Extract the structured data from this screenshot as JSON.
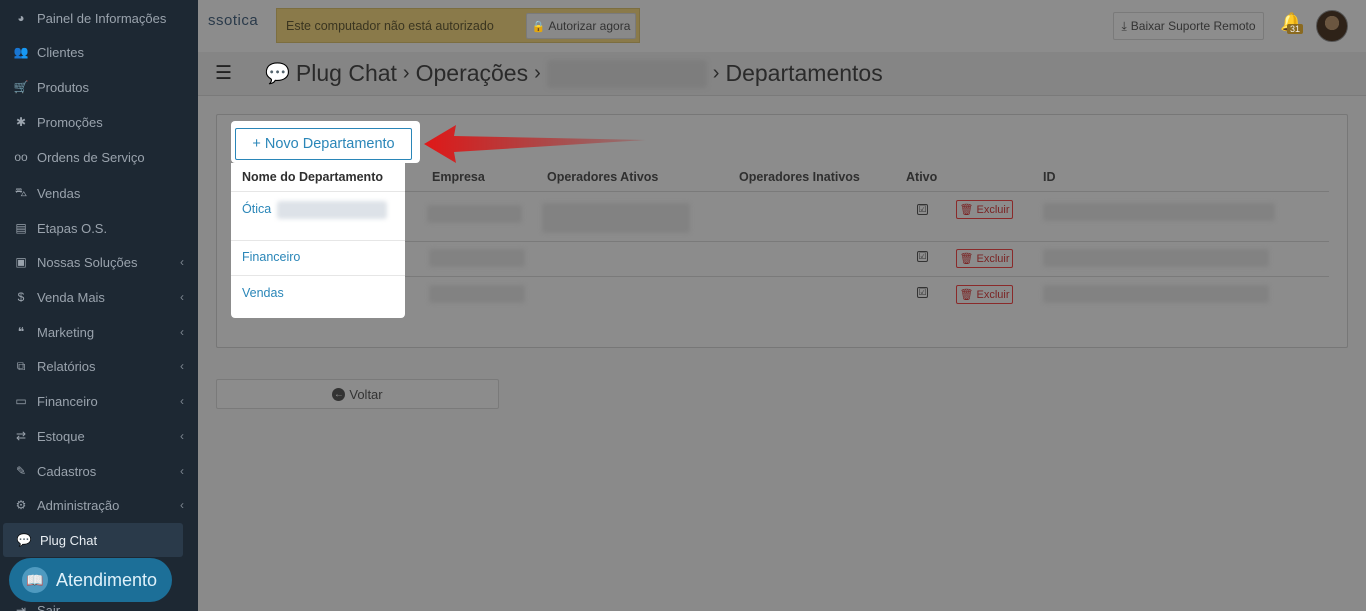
{
  "sidebar": {
    "items": [
      {
        "label": "Painel de Informações",
        "icon": "dashboard-icon",
        "glyph": "◕",
        "chevron": false
      },
      {
        "label": "Clientes",
        "icon": "users-icon",
        "glyph": "👥",
        "chevron": false
      },
      {
        "label": "Produtos",
        "icon": "cart-icon",
        "glyph": "🛒",
        "chevron": false
      },
      {
        "label": "Promoções",
        "icon": "asterisk-icon",
        "glyph": "✱",
        "chevron": false
      },
      {
        "label": "Ordens de Serviço",
        "icon": "glasses-icon",
        "glyph": "oo",
        "chevron": false
      },
      {
        "label": "Vendas",
        "icon": "basket-icon",
        "glyph": "⛍",
        "chevron": false
      },
      {
        "label": "Etapas O.S.",
        "icon": "stages-icon",
        "glyph": "▤",
        "chevron": false
      },
      {
        "label": "Nossas Soluções",
        "icon": "briefcase-icon",
        "glyph": "▣",
        "chevron": true
      },
      {
        "label": "Venda Mais",
        "icon": "dollar-icon",
        "glyph": "$",
        "chevron": true
      },
      {
        "label": "Marketing",
        "icon": "comments-icon",
        "glyph": "❝",
        "chevron": true
      },
      {
        "label": "Relatórios",
        "icon": "copy-icon",
        "glyph": "⧉",
        "chevron": true
      },
      {
        "label": "Financeiro",
        "icon": "money-icon",
        "glyph": "▭",
        "chevron": true
      },
      {
        "label": "Estoque",
        "icon": "exchange-icon",
        "glyph": "⇄",
        "chevron": true
      },
      {
        "label": "Cadastros",
        "icon": "edit-icon",
        "glyph": "✎",
        "chevron": true
      },
      {
        "label": "Administração",
        "icon": "cogs-icon",
        "glyph": "⚙",
        "chevron": true
      },
      {
        "label": "Plug Chat",
        "icon": "chat-icon",
        "glyph": "💬",
        "chevron": false,
        "active": true
      },
      {
        "label": "Sair",
        "icon": "signout-icon",
        "glyph": "⇥",
        "chevron": false
      }
    ],
    "atendimento_label": "Atendimento"
  },
  "topbar": {
    "logo_text": "ssotica",
    "auth_message": "Este computador não está autorizado",
    "auth_button": "Autorizar agora",
    "support_button": "Baixar Suporte Remoto",
    "notification_count": "31"
  },
  "breadcrumb": {
    "root": "Plug Chat",
    "level2": "Operações",
    "current": "Departamentos"
  },
  "main": {
    "new_button": "+ Novo Departamento",
    "columns": [
      "Nome do Departamento",
      "Empresa",
      "Operadores Ativos",
      "Operadores Inativos",
      "Ativo",
      "ID"
    ],
    "rows": [
      {
        "name": "Ótica",
        "active": "☑",
        "delete_label": "Excluir"
      },
      {
        "name": "Financeiro",
        "active": "☑",
        "delete_label": "Excluir"
      },
      {
        "name": "Vendas",
        "active": "☑",
        "delete_label": "Excluir"
      }
    ],
    "back_button": "Voltar"
  }
}
